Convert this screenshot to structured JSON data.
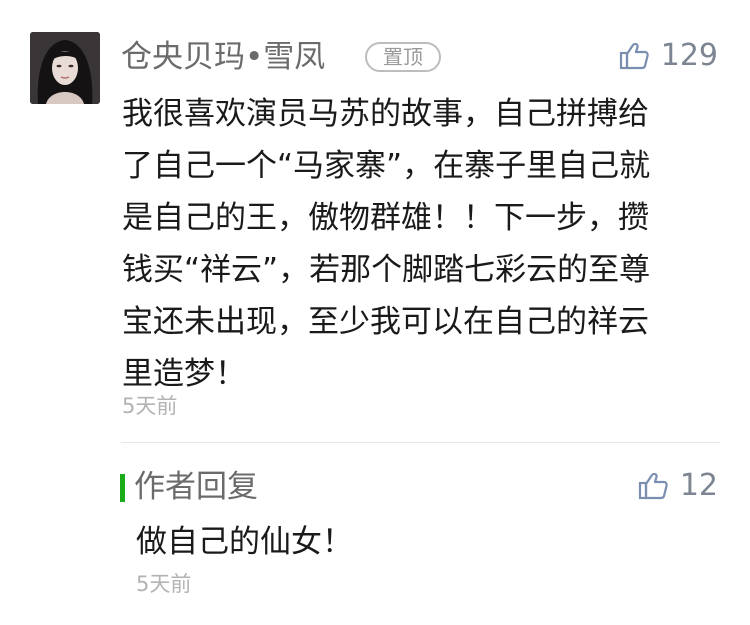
{
  "comment": {
    "author": "仓央贝玛•雪凤",
    "pin_badge": "置顶",
    "likes": "129",
    "lines": [
      "我很喜欢演员马苏的故事，自己拼搏给",
      "了自己一个“马家寨”，在寨子里自己就",
      "是自己的王，傲物群雄！！下一步，攒",
      "钱买“祥云”，若那个脚踏七彩云的至尊",
      "宝还未出现，至少我可以在自己的祥云",
      "里造梦！"
    ],
    "time": "5天前"
  },
  "reply": {
    "label": "作者回复",
    "likes": "12",
    "text": "做自己的仙女！",
    "time": "5天前"
  },
  "icons": {
    "avatar": "avatar-photo",
    "like": "thumbs-up-icon"
  },
  "colors": {
    "accent_green": "#1aad19",
    "name_gray": "#6b6b6b",
    "text": "#1a1a1a",
    "time_gray": "#b3b3b3"
  }
}
